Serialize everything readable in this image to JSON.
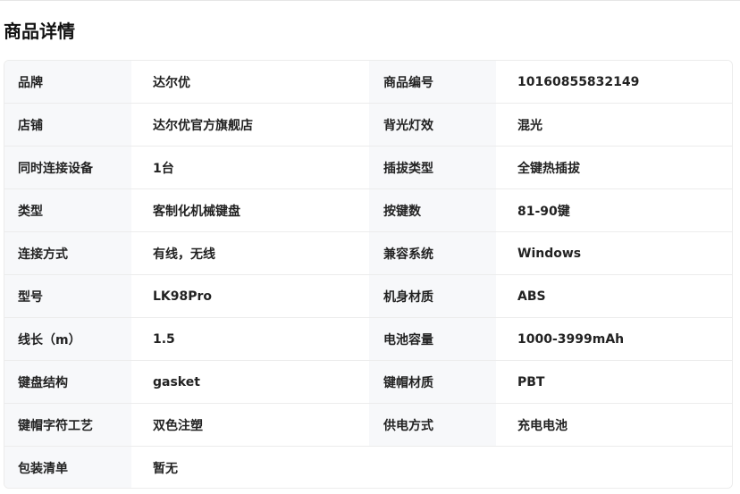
{
  "section_title": "商品详情",
  "rows": [
    {
      "k1": "品牌",
      "v1": "达尔优",
      "k2": "商品编号",
      "v2": "10160855832149"
    },
    {
      "k1": "店铺",
      "v1": "达尔优官方旗舰店",
      "k2": "背光灯效",
      "v2": "混光"
    },
    {
      "k1": "同时连接设备",
      "v1": "1台",
      "k2": "插拔类型",
      "v2": "全键热插拔"
    },
    {
      "k1": "类型",
      "v1": "客制化机械键盘",
      "k2": "按键数",
      "v2": "81-90键"
    },
    {
      "k1": "连接方式",
      "v1": "有线，无线",
      "k2": "兼容系统",
      "v2": "Windows"
    },
    {
      "k1": "型号",
      "v1": "LK98Pro",
      "k2": "机身材质",
      "v2": "ABS"
    },
    {
      "k1": "线长（m）",
      "v1": "1.5",
      "k2": "电池容量",
      "v2": "1000-3999mAh"
    },
    {
      "k1": "键盘结构",
      "v1": "gasket",
      "k2": "键帽材质",
      "v2": "PBT"
    },
    {
      "k1": "键帽字符工艺",
      "v1": "双色注塑",
      "k2": "供电方式",
      "v2": "充电电池"
    }
  ],
  "last_row": {
    "k1": "包装清单",
    "v1": "暂无"
  }
}
